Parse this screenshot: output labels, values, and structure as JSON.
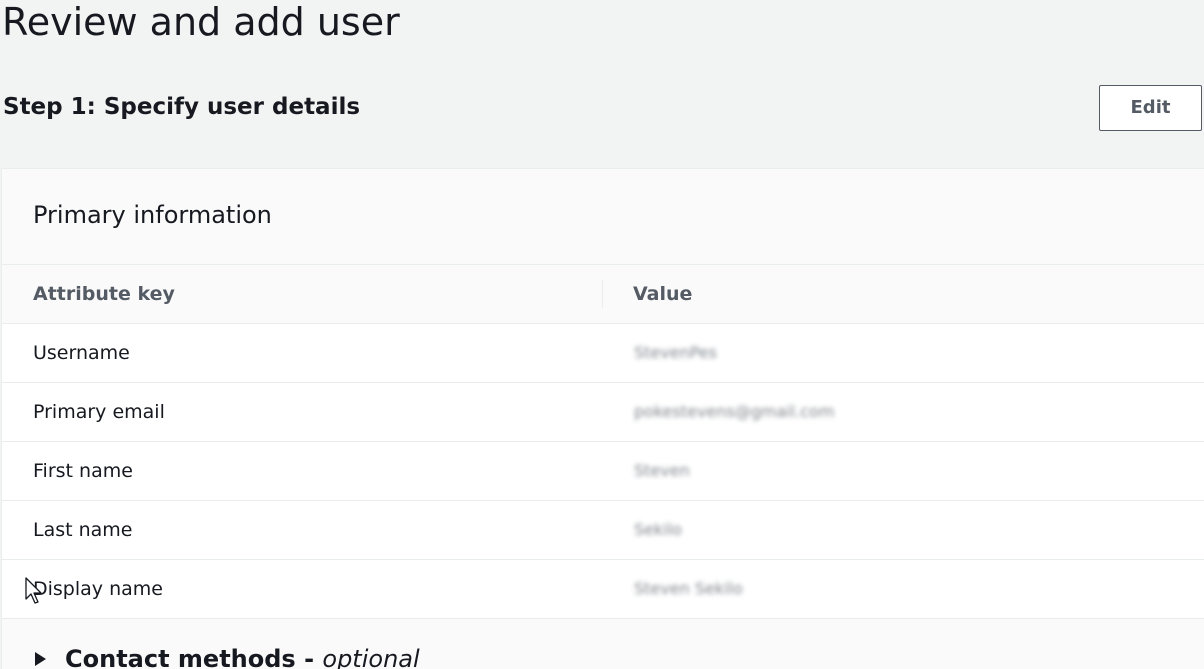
{
  "page": {
    "title": "Review and add user"
  },
  "step": {
    "header": "Step 1: Specify user details",
    "edit_label": "Edit"
  },
  "primary_info": {
    "title": "Primary information",
    "columns": {
      "key": "Attribute key",
      "value": "Value"
    },
    "rows": [
      {
        "key": "Username",
        "value": "StevenPes"
      },
      {
        "key": "Primary email",
        "value": "pokestevens@gmail.com"
      },
      {
        "key": "First name",
        "value": "Steven"
      },
      {
        "key": "Last name",
        "value": "Sekilo"
      },
      {
        "key": "Display name",
        "value": "Steven Sekilo"
      }
    ]
  },
  "contact_methods": {
    "label": "Contact methods - ",
    "optional": "optional"
  },
  "icons": {
    "expand": "caret-right-icon",
    "pointer": "mouse-cursor-icon"
  },
  "colors": {
    "background": "#f2f3f3",
    "text": "#16191f",
    "secondary_text": "#545b64",
    "border": "#eaeded"
  }
}
